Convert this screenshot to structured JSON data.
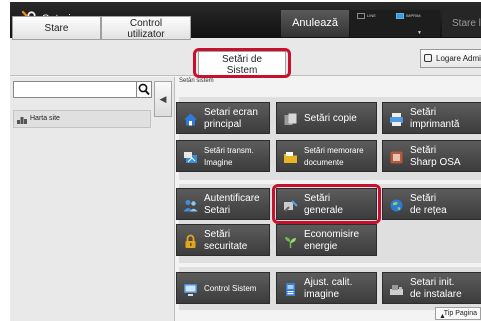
{
  "header": {
    "title": "Setari",
    "cancel_label": "Anulează",
    "led_line": "LINE",
    "led_print": "IMPRIM.",
    "job_status_label": "Stare lucrare"
  },
  "tabs": [
    {
      "line1": "Stare",
      "line2": ""
    },
    {
      "line1": "Control",
      "line2": "utilizator"
    },
    {
      "line1": "Setări de",
      "line2": "Sistem"
    }
  ],
  "login_label": "Logare Admi",
  "sidebar": {
    "search_value": "",
    "items": [
      {
        "label": "Harta site"
      }
    ]
  },
  "breadcrumb": "Setări sistem",
  "menu_groups": [
    [
      {
        "line1": "Setari ecran",
        "line2": "principal",
        "icon": "home-icon",
        "icon_color": "#2f7bd6"
      },
      {
        "line1": "Setări copie",
        "line2": "",
        "icon": "copy-icon",
        "icon_color": "#d8d8d8"
      },
      {
        "line1": "Setări",
        "line2": "imprimantă",
        "icon": "printer-icon",
        "icon_color": "#4f9be0"
      },
      {
        "line1": "Setări transm.",
        "line2": "Imagine",
        "icon": "image-send-icon",
        "icon_color": "#3b8fdc"
      },
      {
        "line1": "Setări memorare",
        "line2": "documente",
        "icon": "folder-icon",
        "icon_color": "#e7b422"
      },
      {
        "line1": "Setări",
        "line2": "Sharp OSA",
        "icon": "osa-icon",
        "icon_color": "#b25a3b"
      }
    ],
    [
      {
        "line1": "Autentificare",
        "line2": "Setari",
        "icon": "users-icon",
        "icon_color": "#3d8fe0"
      },
      {
        "line1": "Setări",
        "line2": "generale",
        "icon": "general-settings-icon",
        "icon_color": "#cccccc"
      },
      {
        "line1": "Setări",
        "line2": "de rețea",
        "icon": "globe-icon",
        "icon_color": "#2d7ad0"
      },
      {
        "line1": "Setări",
        "line2": "securitate",
        "icon": "lock-icon",
        "icon_color": "#e2a51d"
      },
      {
        "line1": "Economisire",
        "line2": "energie",
        "icon": "leaf-icon",
        "icon_color": "#6cc04a"
      }
    ],
    [
      {
        "line1": "Control Sistem",
        "line2": "",
        "icon": "system-control-icon",
        "icon_color": "#4a90d9"
      },
      {
        "line1": "Ajust. calit.",
        "line2": "imagine",
        "icon": "image-quality-icon",
        "icon_color": "#3b7fcf"
      },
      {
        "line1": "Setari init.",
        "line2": "de instalare",
        "icon": "install-icon",
        "icon_color": "#cfcfcf"
      }
    ]
  ],
  "tip_label": "Tip Pagina",
  "highlight_color": "#c8102e"
}
